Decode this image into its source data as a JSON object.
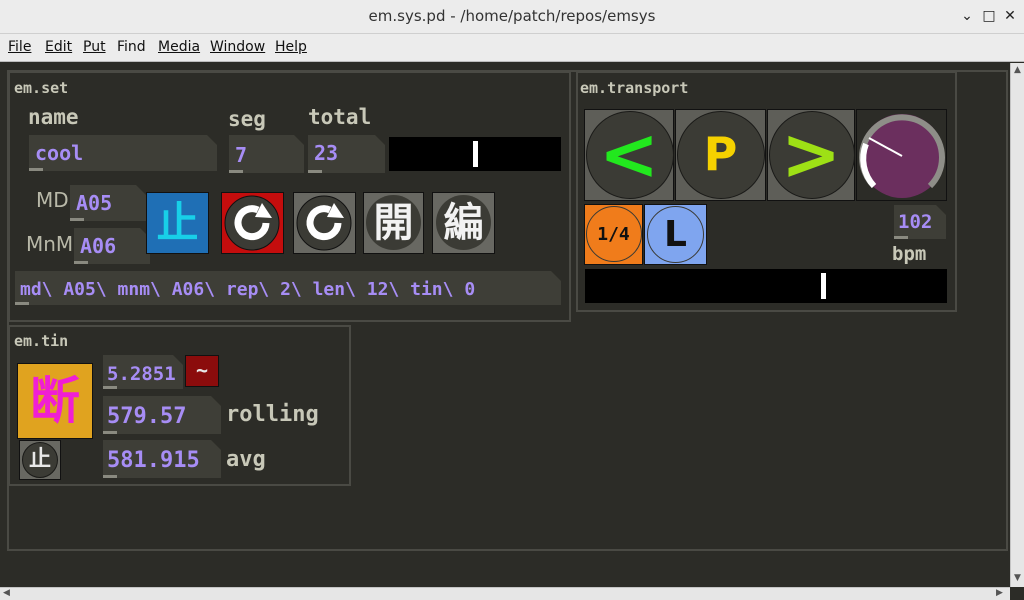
{
  "window": {
    "title": "em.sys.pd  - /home/patch/repos/emsys",
    "controls": [
      "minimize-icon",
      "maximize-icon",
      "close-icon"
    ]
  },
  "menu": [
    "File",
    "Edit",
    "Put",
    "Find",
    "Media",
    "Window",
    "Help"
  ],
  "em_set": {
    "title": "em.set",
    "name_label": "name",
    "name_value": "cool",
    "seg_label": "seg",
    "seg_value": "7",
    "total_label": "total",
    "total_value": "23",
    "md_label": "MD",
    "md_value": "A05",
    "mnm_label": "MnM",
    "mnm_value": "A06",
    "stop_glyph": "止",
    "open_glyph": "開",
    "edit_glyph": "編",
    "message": "md\\ A05\\ mnm\\ A06\\ rep\\ 2\\ len\\ 12\\ tin\\ 0",
    "progress": 0.5
  },
  "em_transport": {
    "title": "em.transport",
    "prev_label": "<",
    "play_label": "P",
    "next_label": ">",
    "div_label": "1/4",
    "loop_label": "L",
    "bpm_value": "102",
    "bpm_label": "bpm",
    "progress": 0.66
  },
  "em_tin": {
    "title": "em.tin",
    "break_glyph": "断",
    "small_stop_glyph": "止",
    "value1": "5.2851",
    "tilde": "~",
    "value2": "579.57",
    "rolling_label": "rolling",
    "value3": "581.915",
    "avg_label": "avg"
  },
  "colors": {
    "canvas_bg": "#2c2c27",
    "atom_bg": "#3e3e37",
    "number_text": "#a78df5",
    "green_arrow": "#22e81e",
    "yellow_play": "#f5d100",
    "knob_purple": "#6b2f5e",
    "orange": "#f07c1b",
    "blue": "#7fa5ef",
    "stop_blue": "#1f6fb5",
    "cyan_text": "#18cfe8",
    "red": "#c40d0d",
    "magenta_text": "#f01fd4",
    "gold": "#e0a31f",
    "dark_red": "#8b0c0c"
  }
}
